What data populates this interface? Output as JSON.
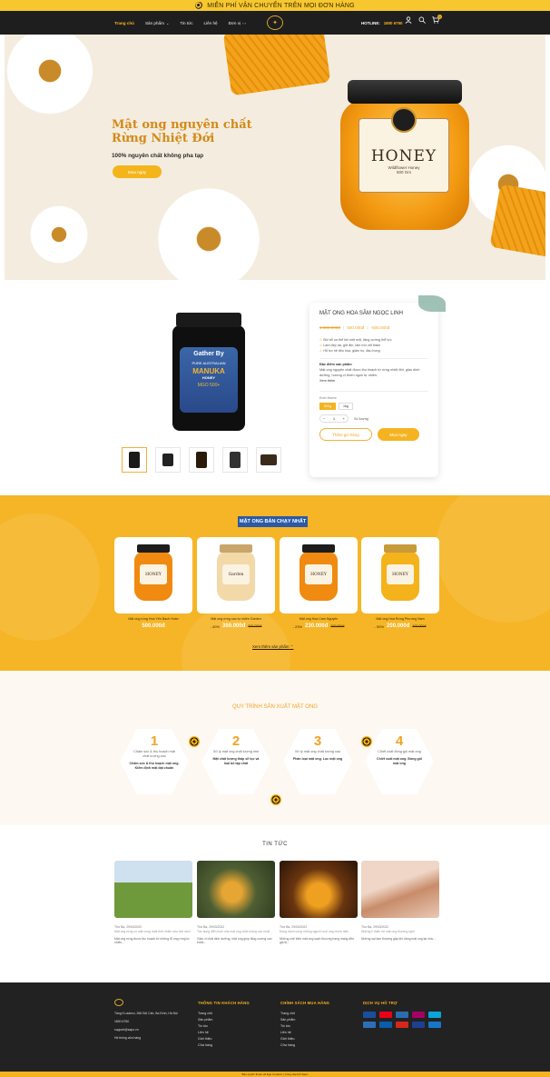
{
  "topbar": {
    "text": "MIỄN PHÍ VẬN CHUYỂN TRÊN MỌI ĐƠN HÀNG"
  },
  "nav": {
    "items": [
      "Trang chủ",
      "Sản phẩm",
      "Tin tức",
      "Liên hệ",
      "Đơn vị"
    ],
    "logo_text": "HONEY BEE FARM",
    "hotline_label": "HOTLINE:",
    "hotline_number": "1800 6750",
    "cart_count": "0"
  },
  "hero": {
    "title_line1": "Mật ong nguyên chất",
    "title_line2": "Rừng Nhiệt Đới",
    "subtitle": "100% nguyên chất không pha tạp",
    "button": "Mua ngay",
    "jar_label_big": "HONEY",
    "jar_label_small": "Wildflower Honey",
    "jar_weight": "500 Gm"
  },
  "product": {
    "name": "MẬT ONG HOA SÂM NGỌC LINH",
    "price_old": "1.000.000đ",
    "price_new": "500.000đ",
    "price_discount": "-500.000đ",
    "jar_brand": "Gather By",
    "jar_line1": "PURE AUSTRALIAN",
    "jar_line2": "MANUKA",
    "jar_line3": "HONEY",
    "jar_mgo": "MGO 500+",
    "bullets": [
      "Bồi bổ cơ thể khi mệt mỏi, tăng cường thể lực",
      "Làm đẹp da, giữ ẩm, làm mờ vết thâm",
      "Hỗ trợ hệ tiêu hóa, giảm ho, đau họng"
    ],
    "desc_head": "Đặc điểm sản phẩm",
    "desc_text": "Mật ong nguyên chất được thu hoạch từ rừng nhiệt đới, giàu dinh dưỡng, hương vị thơm ngon tự nhiên.",
    "desc_more": "Xem thêm",
    "size_label": "Kích thước",
    "sizes": [
      "500g",
      "1kg"
    ],
    "qty": "1",
    "qty_label": "Số lượng",
    "add_cart": "Thêm giỏ hàng",
    "buy_now": "Mua ngay"
  },
  "bestseller": {
    "title": "MẬT ONG BÁN CHẠY NHẤT",
    "more": "Xem thêm sản phẩm",
    "items": [
      {
        "name": "Mật ong rừng Hoa Yến Bạch Hoàn",
        "discount": "",
        "price": "500.000đ",
        "old": "",
        "label": "HONEY",
        "cap": "#1d1d1d",
        "body": "#f08a10"
      },
      {
        "name": "Mật ong rừng cao tự nhiên Garden",
        "discount": "- 40%",
        "price": "300.000đ",
        "old": "500.000đ",
        "label": "Garden",
        "cap": "#c8a56a",
        "body": "#f3d9a8"
      },
      {
        "name": "Mật ong Hoa Cam Nguyên",
        "discount": "- 23%",
        "price": "230.000đ",
        "old": "300.000đ",
        "label": "HONEY",
        "cap": "#1d1d1d",
        "body": "#f08a10"
      },
      {
        "name": "Mật ong Hoa Rừng Phương Nam",
        "discount": "- 50%",
        "price": "200.000đ",
        "old": "400.000đ",
        "label": "HONEY",
        "cap": "#c79a3a",
        "body": "#f4b21b"
      }
    ]
  },
  "process": {
    "title": "QUY TRÌNH SẢN XUẤT MẬT ONG",
    "steps": [
      {
        "n": "1",
        "t": "Chăm sóc & thu hoạch mật chất lượng cao",
        "s": "Chăm sóc & thu hoạch mật ong. Kiểm định mật đạt chuẩn"
      },
      {
        "n": "2",
        "t": "Xử lý mật ong chất lượng nhẹ",
        "s": "Mật chất lượng thấp sẽ lọc và loại bỏ tạp chất"
      },
      {
        "n": "3",
        "t": "Xử lý mật ong chất lượng cao",
        "s": "Phân loại mật ong. Lọc mật ong"
      },
      {
        "n": "4",
        "t": "Chiết xuất đóng gói mật ong",
        "s": "Chiết xuất mật ong. Đóng gói mật ong"
      }
    ]
  },
  "news": {
    "title": "TIN TỨC",
    "items": [
      {
        "date": "Thứ Ba, 29/03/2022",
        "head": "Mật ong rừng có mặt cong nhất thời nhiên như thế nào?",
        "ex": "Mật ong rừng được thu hoạch từ những tổ ong rừng tự nhiên..."
      },
      {
        "date": "Thứ Ba, 29/03/2022",
        "head": "Tác dụng điển hình của mật ong chất lượng cao nhất",
        "ex": "Giàu vi chất dinh dưỡng, mật ong giúp tăng cường sức khỏe..."
      },
      {
        "date": "Thứ Ba, 29/03/2022",
        "head": "Đồng hành cùng những người nuôi ong chính hiệu",
        "ex": "Những chế biến mật ong sạch thượng hạng mang đến giá trị..."
      },
      {
        "date": "Thứ Ba, 29/03/2022",
        "head": "Những lí thiên lời mật ong thường nghĩ",
        "ex": "Những sai lầm thường gặp khi dùng mật ong tại nhà..."
      }
    ]
  },
  "footer": {
    "address": "Tầng 6 Ladeco, 266 Đội Cấn, Ba Đình, Hà Nội",
    "phone": "1800 6750",
    "email": "support@sapo.vn",
    "system": "Hệ thống cửa hàng",
    "col1_title": "THÔNG TIN KHÁCH HÀNG",
    "col1": [
      "Trang chủ",
      "Sản phẩm",
      "Tin tức",
      "Liên hệ",
      "Giới thiệu",
      "Cửa hàng"
    ],
    "col2_title": "CHÍNH SÁCH MUA HÀNG",
    "col2": [
      "Trang chủ",
      "Sản phẩm",
      "Tin tức",
      "Liên hệ",
      "Giới thiệu",
      "Cửa hàng"
    ],
    "col3_title": "DỊCH VỤ HỖ TRỢ",
    "copyright": "Bản quyền thuộc về Ego Creative | Cung cấp bởi Sapo"
  },
  "colors": {
    "accent": "#f5b320",
    "dark": "#1e1e1e",
    "hero_bg": "#f4ecdf"
  }
}
